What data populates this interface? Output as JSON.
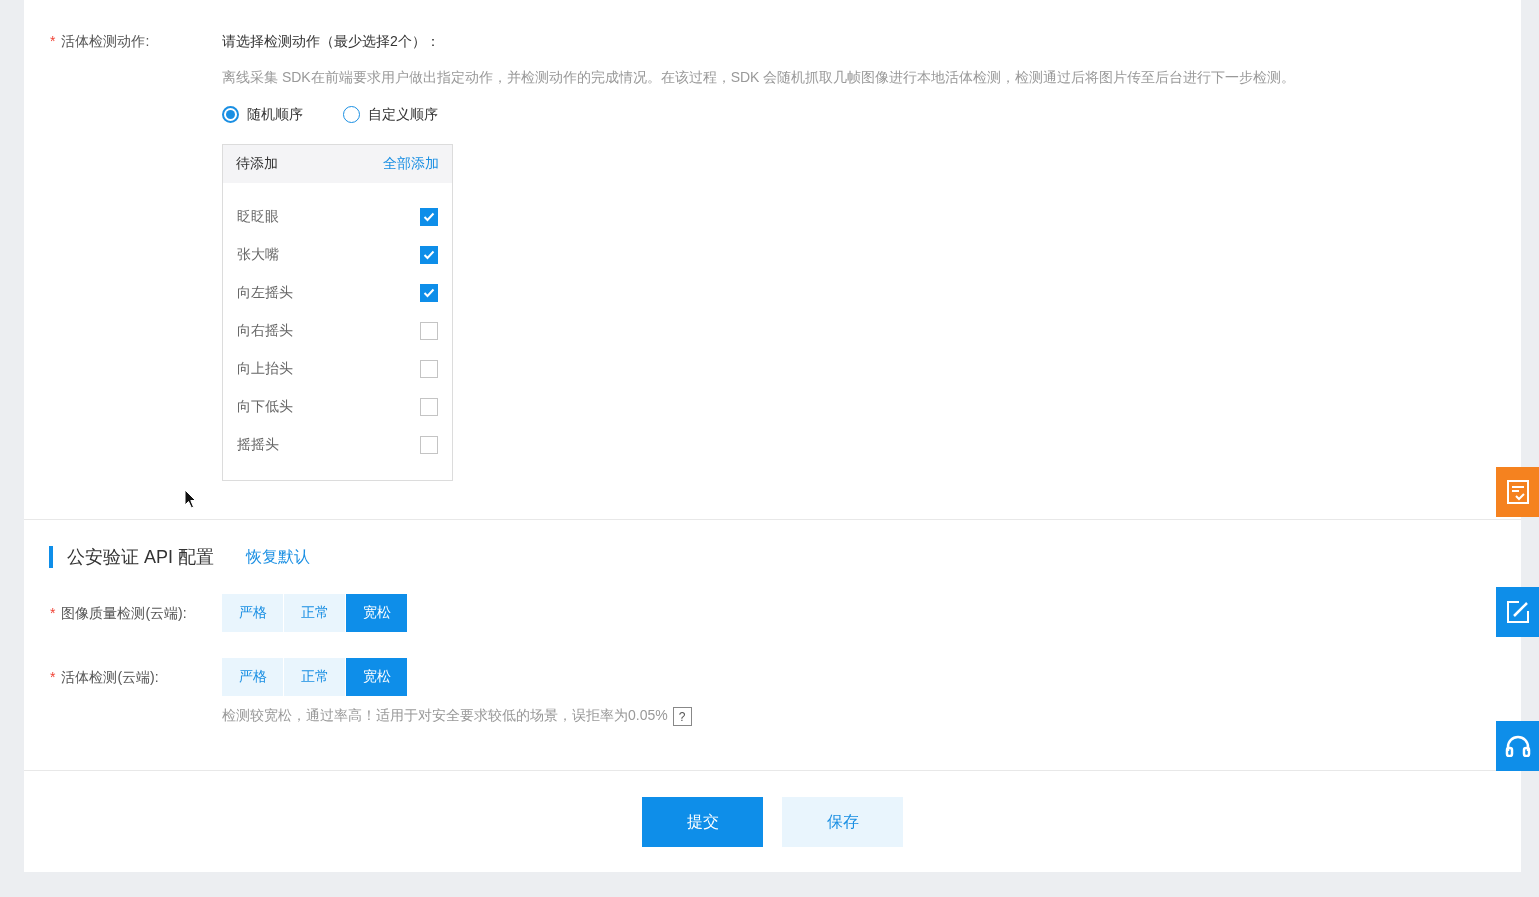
{
  "liveness_actions": {
    "required_mark": "*",
    "label": "活体检测动作:",
    "prompt": "请选择检测动作（最少选择2个）：",
    "description": "离线采集 SDK在前端要求用户做出指定动作，并检测动作的完成情况。在该过程，SDK 会随机抓取几帧图像进行本地活体检测，检测通过后将图片传至后台进行下一步检测。",
    "order_options": [
      {
        "label": "随机顺序",
        "selected": true
      },
      {
        "label": "自定义顺序",
        "selected": false
      }
    ],
    "action_list": {
      "title": "待添加",
      "add_all": "全部添加",
      "items": [
        {
          "label": "眨眨眼",
          "checked": true
        },
        {
          "label": "张大嘴",
          "checked": true
        },
        {
          "label": "向左摇头",
          "checked": true
        },
        {
          "label": "向右摇头",
          "checked": false
        },
        {
          "label": "向上抬头",
          "checked": false
        },
        {
          "label": "向下低头",
          "checked": false
        },
        {
          "label": "摇摇头",
          "checked": false
        }
      ]
    }
  },
  "api_config": {
    "title": "公安验证 API 配置",
    "reset_link": "恢复默认",
    "settings": [
      {
        "required_mark": "*",
        "label": "图像质量检测(云端):",
        "options": [
          {
            "label": "严格",
            "selected": false
          },
          {
            "label": "正常",
            "selected": false
          },
          {
            "label": "宽松",
            "selected": true
          }
        ]
      },
      {
        "required_mark": "*",
        "label": "活体检测(云端):",
        "options": [
          {
            "label": "严格",
            "selected": false
          },
          {
            "label": "正常",
            "selected": false
          },
          {
            "label": "宽松",
            "selected": true
          }
        ],
        "hint": "检测较宽松，通过率高！适用于对安全要求较低的场景，误拒率为0.05%",
        "help_icon": "?"
      }
    ]
  },
  "footer": {
    "buttons": [
      {
        "label": "提交",
        "kind": "primary"
      },
      {
        "label": "保存",
        "kind": "secondary"
      }
    ]
  }
}
